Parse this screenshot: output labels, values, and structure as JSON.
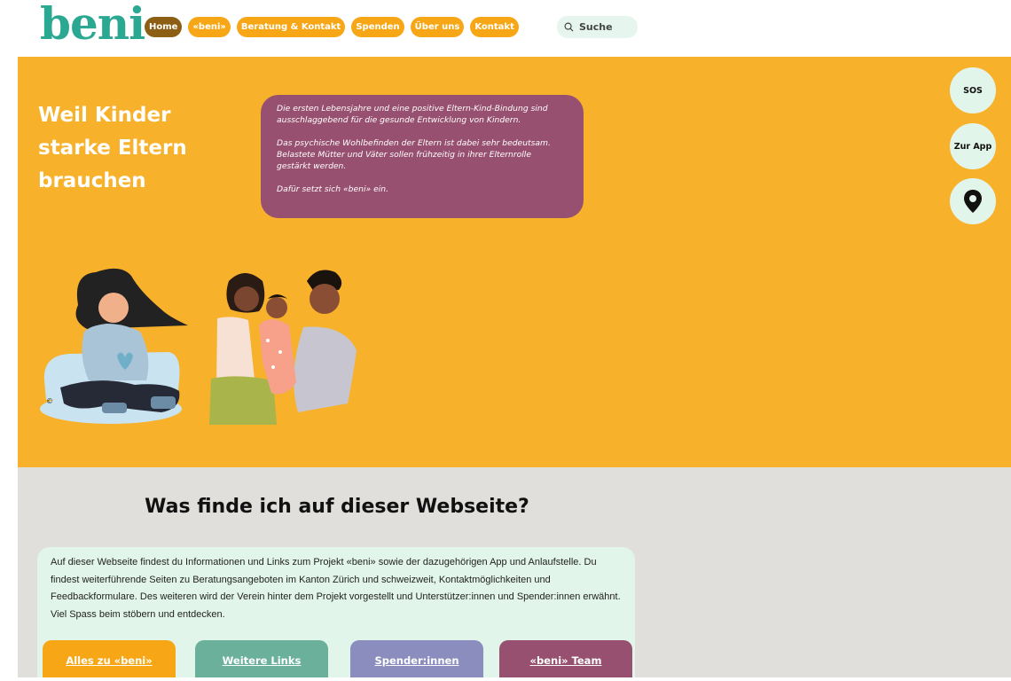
{
  "header": {
    "logo": "beni",
    "nav": [
      {
        "label": "Home"
      },
      {
        "label": "«beni»"
      },
      {
        "label": "Beratung & Kontakt"
      },
      {
        "label": "Spenden"
      },
      {
        "label": "Über uns"
      },
      {
        "label": "Kontakt"
      }
    ],
    "search": {
      "placeholder": "Suche"
    }
  },
  "hero": {
    "title": "Weil Kinder starke Eltern brauchen",
    "paragraphs": [
      "Die ersten Lebensjahre und eine positive Eltern-Kind-Bindung sind ausschlaggebend für die gesunde Entwicklung von Kindern.",
      "Das psychische Wohlbefinden der Eltern ist dabei sehr bedeutsam. Belastete Mütter und Väter sollen frühzeitig in ihrer Elternrolle gestärkt werden.",
      "Dafür setzt sich «beni» ein."
    ],
    "copyright": "©"
  },
  "floating": {
    "sos": "SOS",
    "app": "Zur App",
    "location_icon": "map-pin-icon"
  },
  "section": {
    "title": "Was finde ich auf dieser Webseite?",
    "text": "Auf dieser Webseite findest du Informationen und Links zum Projekt «beni» sowie der dazugehörigen App und Anlaufstelle. Du findest weiterführende Seiten zu Beratungsangeboten im Kanton Zürich und schweizweit, Kontaktmöglichkeiten und Feedbackformulare. Des weiteren wird der Verein hinter dem Projekt vorgestellt und Unterstützer:innen und Spender:innen erwähnt. Viel Spass beim stöbern und entdecken.",
    "cards": [
      {
        "label": "Alles zu «beni»",
        "color": "#f7a716"
      },
      {
        "label": "Weitere Links",
        "color": "#6bb09b"
      },
      {
        "label": "Spender:innen",
        "color": "#8a8dbd"
      },
      {
        "label": "«beni» Team",
        "color": "#97506f"
      }
    ]
  },
  "colors": {
    "brand": "#2aa891",
    "hero_bg": "#f7b12a",
    "nav": "#f7a716",
    "nav_active": "#8d5f14",
    "box": "#97506f",
    "section_bg": "#e0dfdb",
    "card_bg": "#e2f5ea"
  }
}
